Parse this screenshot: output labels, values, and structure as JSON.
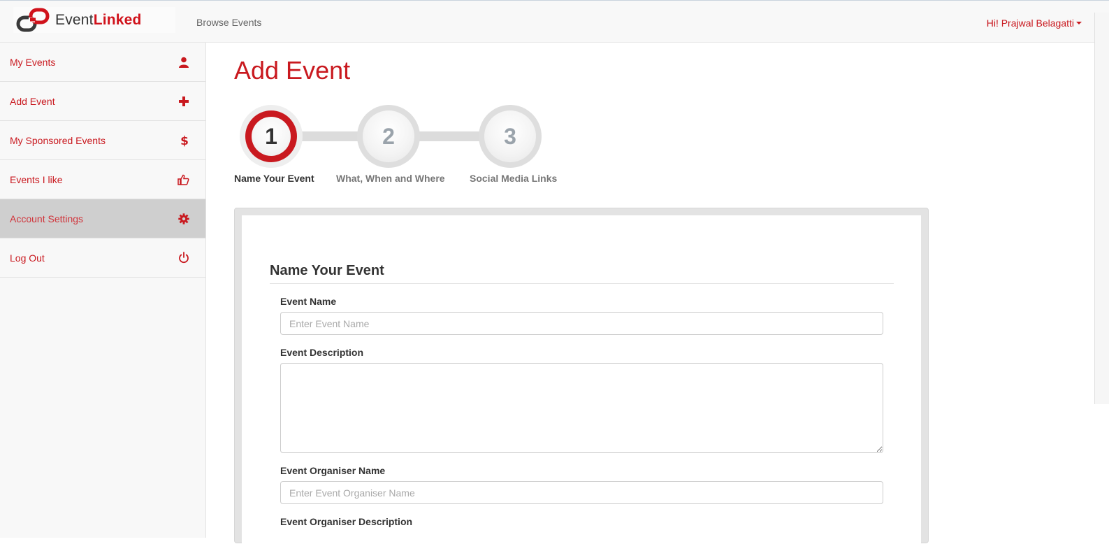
{
  "navbar": {
    "logo_text_plain": "Event",
    "logo_text_bold": "Linked",
    "browse_label": "Browse Events",
    "user_greeting": "Hi! Prajwal Belagatti"
  },
  "sidebar": {
    "items": [
      {
        "label": "My Events",
        "icon": "user-icon"
      },
      {
        "label": "Add Event",
        "icon": "plus-icon"
      },
      {
        "label": "My Sponsored Events",
        "icon": "dollar-icon"
      },
      {
        "label": "Events I like",
        "icon": "thumbs-up-icon"
      },
      {
        "label": "Account Settings",
        "icon": "gear-icon",
        "active": true
      },
      {
        "label": "Log Out",
        "icon": "power-icon"
      }
    ]
  },
  "page": {
    "title": "Add Event"
  },
  "stepper": {
    "steps": [
      {
        "number": "1",
        "label": "Name Your Event",
        "active": true
      },
      {
        "number": "2",
        "label": "What, When and Where",
        "active": false
      },
      {
        "number": "3",
        "label": "Social Media Links",
        "active": false
      }
    ]
  },
  "form": {
    "heading": "Name Your Event",
    "event_name_label": "Event Name",
    "event_name_placeholder": "Enter Event Name",
    "event_name_value": "",
    "event_description_label": "Event Description",
    "event_description_value": "",
    "organiser_name_label": "Event Organiser Name",
    "organiser_name_placeholder": "Enter Event Organiser Name",
    "organiser_name_value": "",
    "organiser_description_label": "Event Organiser Description"
  },
  "colors": {
    "accent": "#c9191f",
    "active_sidebar_bg": "#cfcfcf",
    "step_label_active": "#333333",
    "step_label_inactive": "#777777"
  }
}
